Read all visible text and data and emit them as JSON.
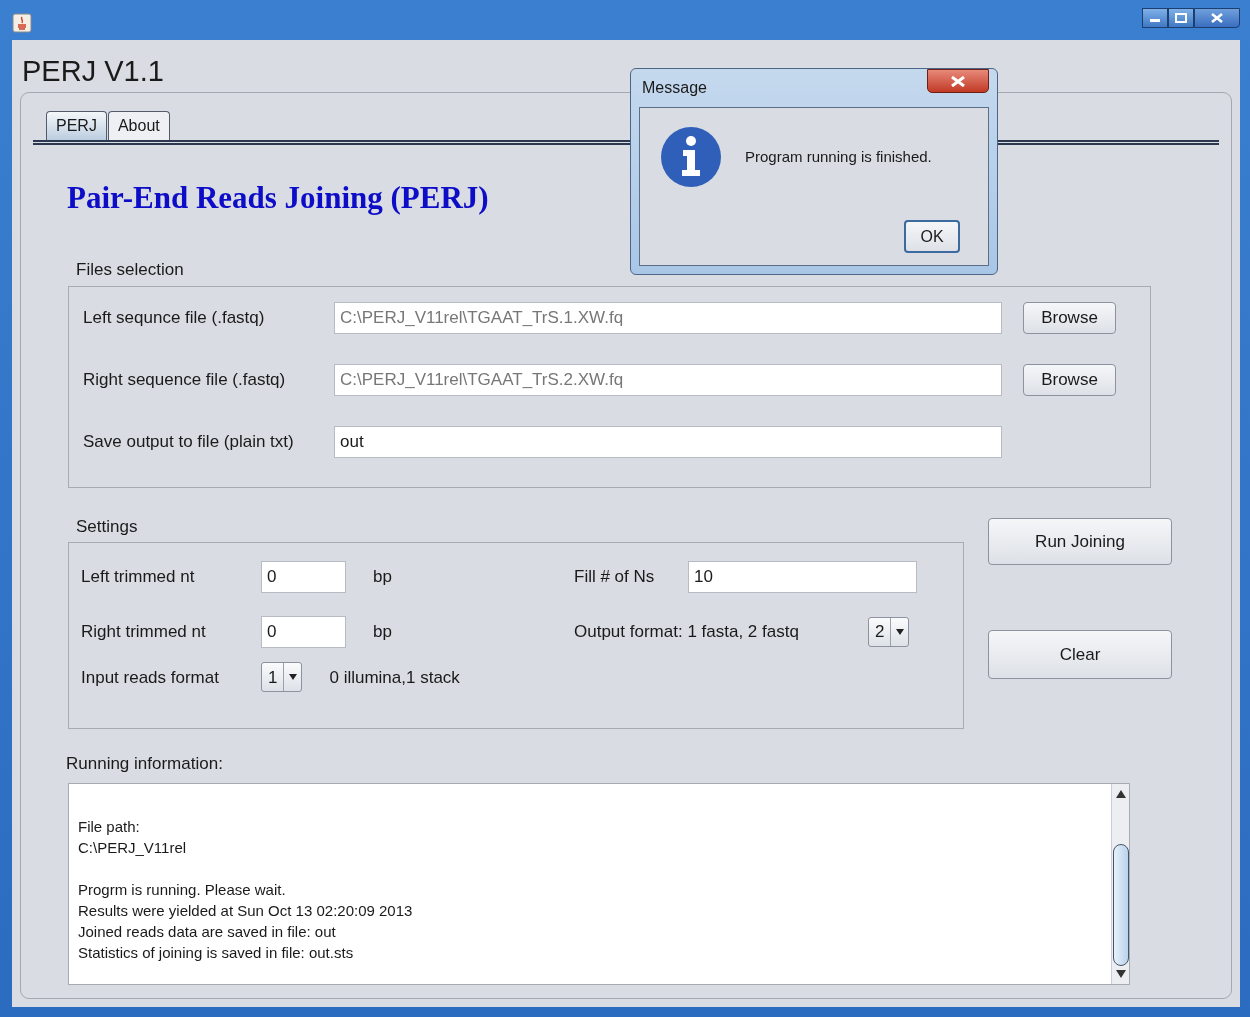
{
  "app_title": "PERJ V1.1",
  "tabs": [
    {
      "label": "PERJ",
      "selected": true
    },
    {
      "label": "About",
      "selected": false
    }
  ],
  "heading": "Pair-End Reads Joining (PERJ)",
  "files_selection": {
    "title": "Files selection",
    "rows": [
      {
        "label": "Left sequnce file (.fastq)",
        "value": "C:\\PERJ_V11rel\\TGAAT_TrS.1.XW.fq",
        "disabled": true,
        "button": "Browse"
      },
      {
        "label": "Right sequence file (.fastq)",
        "value": "C:\\PERJ_V11rel\\TGAAT_TrS.2.XW.fq",
        "disabled": true,
        "button": "Browse"
      },
      {
        "label": "Save output to file (plain txt)",
        "value": "out",
        "disabled": false
      }
    ]
  },
  "settings": {
    "title": "Settings",
    "left": [
      {
        "kind": "text",
        "label": "Left trimmed nt",
        "value": "0",
        "unit": "bp"
      },
      {
        "kind": "text",
        "label": "Right trimmed nt",
        "value": "0",
        "unit": "bp"
      },
      {
        "kind": "combo",
        "label": "Input reads format",
        "value": "1",
        "unit": "0 illumina,1 stack"
      }
    ],
    "right": [
      {
        "kind": "text",
        "label": "Fill # of Ns",
        "value": "10"
      },
      {
        "kind": "combo",
        "label": "Output format: 1 fasta, 2 fastq",
        "value": "2"
      }
    ]
  },
  "actions": [
    "Run Joining",
    "Clear"
  ],
  "running_information": {
    "title": "Running information:",
    "paragraphs": [
      [
        "File path:",
        "C:\\PERJ_V11rel"
      ],
      [
        "Progrm is running. Please wait.",
        "Results were yielded at Sun Oct 13 02:20:09 2013",
        "Joined reads data are saved in file: out",
        "Statistics of joining is saved in file: out.sts"
      ]
    ]
  },
  "dialog": {
    "title": "Message",
    "message": "Program running is finished.",
    "button": "OK"
  }
}
